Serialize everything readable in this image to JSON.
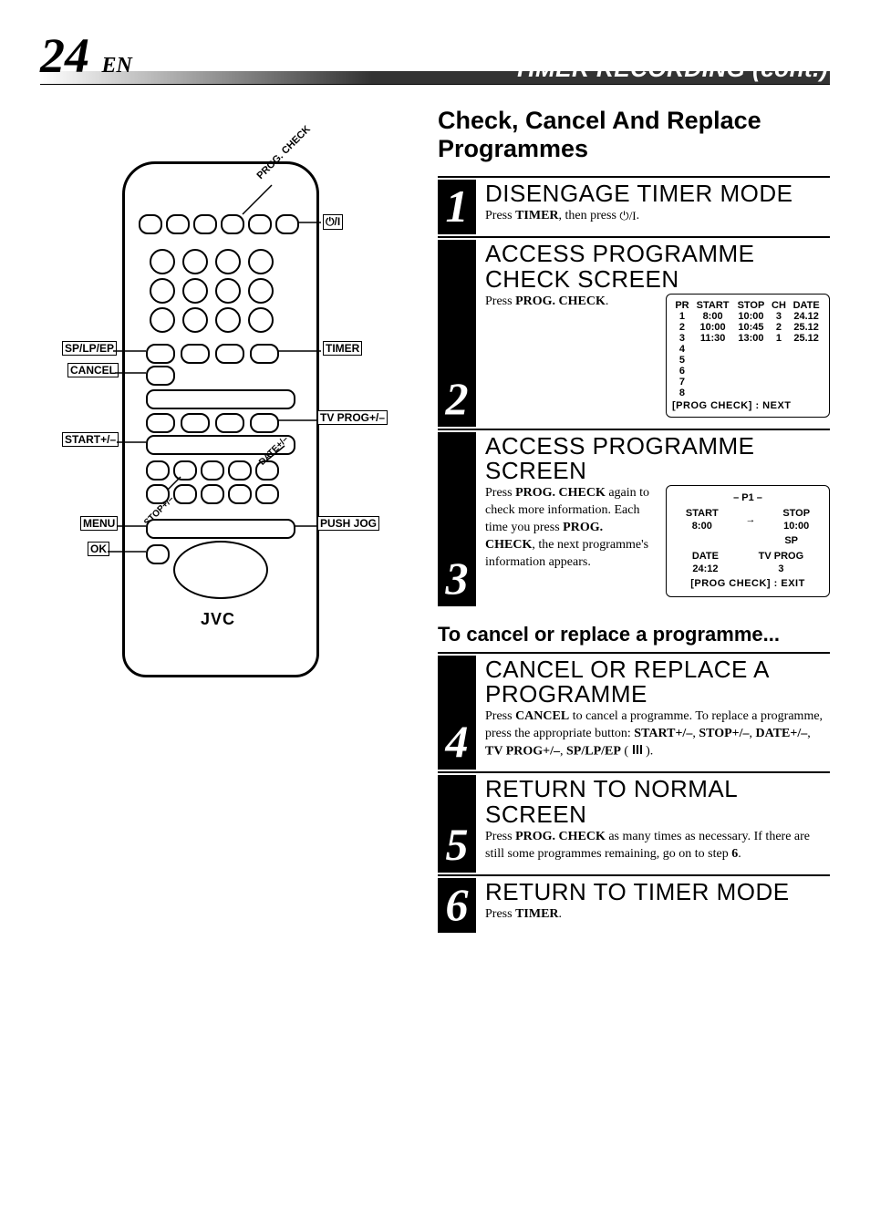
{
  "header": {
    "page_number": "24",
    "lang": "EN",
    "title": "TIMER RECORDING (cont.)"
  },
  "section_title": "Check, Cancel And Replace Programmes",
  "subsection_title": "To cancel or replace a programme...",
  "steps": [
    {
      "num": "1",
      "title": "DISENGAGE TIMER MODE",
      "instr_parts": [
        "Press ",
        "TIMER",
        ", then press ",
        "⏻/I",
        "."
      ]
    },
    {
      "num": "2",
      "title": "ACCESS PROGRAMME CHECK SCREEN",
      "instr_parts": [
        "Press ",
        "PROG. CHECK",
        "."
      ]
    },
    {
      "num": "3",
      "title": "ACCESS PROGRAMME SCREEN",
      "instr_parts": [
        "Press ",
        "PROG. CHECK",
        " again to check more information. Each time you press ",
        "PROG. CHECK",
        ", the next programme's information appears."
      ]
    },
    {
      "num": "4",
      "title": "CANCEL OR REPLACE A PROGRAMME",
      "instr_parts": [
        "Press ",
        "CANCEL",
        " to cancel a programme. To replace a programme, press the appropriate button: ",
        "START+/–",
        ", ",
        "STOP+/–",
        ", ",
        "DATE+/–",
        ", ",
        "TV PROG+/–",
        ", ",
        "SP/LP/EP",
        " ( ",
        "|||",
        " )."
      ]
    },
    {
      "num": "5",
      "title": "RETURN TO NORMAL SCREEN",
      "instr_parts": [
        "Press ",
        "PROG. CHECK",
        " as many times as necessary. If there are still some programmes remaining, go on to step ",
        "6",
        "."
      ]
    },
    {
      "num": "6",
      "title": "RETURN TO TIMER MODE",
      "instr_parts": [
        "Press ",
        "TIMER",
        "."
      ]
    }
  ],
  "osd_list": {
    "headers": [
      "PR",
      "START",
      "STOP",
      "CH",
      "DATE"
    ],
    "rows": [
      [
        "1",
        "8:00",
        "10:00",
        "3",
        "24.12"
      ],
      [
        "2",
        "10:00",
        "10:45",
        "2",
        "25.12"
      ],
      [
        "3",
        "11:30",
        "13:00",
        "1",
        "25.12"
      ],
      [
        "4",
        "",
        "",
        "",
        ""
      ],
      [
        "5",
        "",
        "",
        "",
        ""
      ],
      [
        "6",
        "",
        "",
        "",
        ""
      ],
      [
        "7",
        "",
        "",
        "",
        ""
      ],
      [
        "8",
        "",
        "",
        "",
        ""
      ]
    ],
    "footer": "[PROG CHECK] : NEXT"
  },
  "osd_detail": {
    "header": "– P1 –",
    "start_lbl": "START",
    "start_val": "8:00",
    "arrow": "→",
    "stop_lbl": "STOP",
    "stop_val": "10:00",
    "mode": "SP",
    "date_lbl": "DATE",
    "date_val": "24:12",
    "tvprog_lbl": "TV PROG",
    "tvprog_val": "3",
    "footer": "[PROG CHECK] : EXIT"
  },
  "remote": {
    "brand": "JVC",
    "labels": {
      "prog_check": "PROG. CHECK",
      "power": "⏻/I",
      "splpep": "SP/LP/EP",
      "timer": "TIMER",
      "cancel": "CANCEL",
      "tvprog": "TV PROG+/–",
      "start": "START+/–",
      "stop": "STOP+/–",
      "date": "DATE+/–",
      "menu": "MENU",
      "pushjog": "PUSH JOG",
      "ok": "OK"
    }
  }
}
